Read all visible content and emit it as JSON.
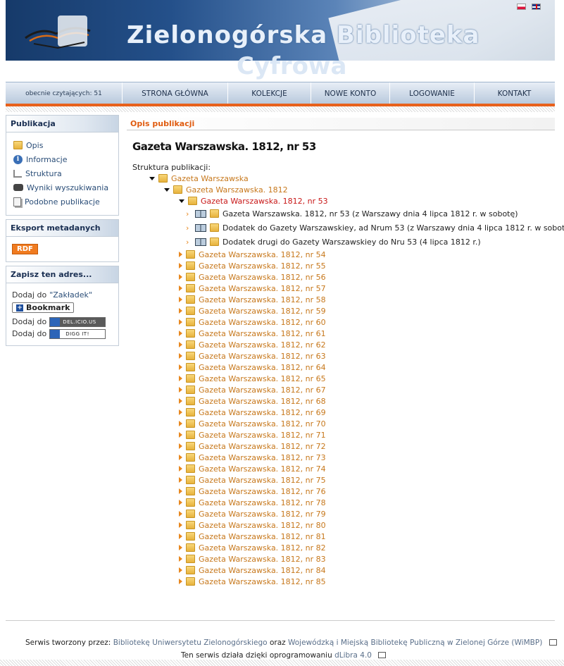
{
  "header": {
    "title_line1": "Zielonogórska Biblioteka",
    "title_line2": "Cyfrowa"
  },
  "nav": {
    "readers": "obecnie czytających: 51",
    "items": [
      "STRONA GŁÓWNA",
      "KOLEKCJE",
      "NOWE KONTO",
      "LOGOWANIE",
      "KONTAKT"
    ]
  },
  "sidebar": {
    "publication": {
      "title": "Publikacja",
      "items": [
        {
          "label": "Opis",
          "icon": "folder-icon"
        },
        {
          "label": "Informacje",
          "icon": "info-icon"
        },
        {
          "label": "Struktura",
          "icon": "tree-icon"
        },
        {
          "label": "Wyniki wyszukiwania",
          "icon": "binoculars-icon"
        },
        {
          "label": "Podobne publikacje",
          "icon": "documents-icon"
        }
      ]
    },
    "export": {
      "title": "Eksport metadanych",
      "rdf": "RDF"
    },
    "save": {
      "title": "Zapisz ten adres...",
      "add_to": "Dodaj do",
      "bookmarks_link": "\"Zakładek\"",
      "bookmark_button": "Bookmark",
      "delicious": "DEL.ICIO.US",
      "digg": "DIGG IT!"
    }
  },
  "main": {
    "section_title": "Opis publikacji",
    "pub_title": "Gazeta Warszawska. 1812, nr 53",
    "structure_label": "Struktura publikacji:",
    "tree": {
      "root": "Gazeta Warszawska",
      "year": "Gazeta Warszawska. 1812",
      "current": "Gazeta Warszawska. 1812, nr 53",
      "docs": [
        "Gazeta Warszawska. 1812, nr 53 (z Warszawy dnia 4 lipca 1812 r. w sobotę)",
        "Dodatek do Gazety Warszawskiey, ad Nrum 53 (z Warszawy dnia 4 lipca 1812 r. w sobotę)",
        "Dodatek drugi do Gazety Warszawskiey do Nru 53 (4 lipca 1812 r.)"
      ],
      "issues": [
        "Gazeta Warszawska. 1812, nr 54",
        "Gazeta Warszawska. 1812, nr 55",
        "Gazeta Warszawska. 1812, nr 56",
        "Gazeta Warszawska. 1812, nr 57",
        "Gazeta Warszawska. 1812, nr 58",
        "Gazeta Warszawska. 1812, nr 59",
        "Gazeta Warszawska. 1812, nr 60",
        "Gazeta Warszawska. 1812, nr 61",
        "Gazeta Warszawska. 1812, nr 62",
        "Gazeta Warszawska. 1812, nr 63",
        "Gazeta Warszawska. 1812, nr 64",
        "Gazeta Warszawska. 1812, nr 65",
        "Gazeta Warszawska. 1812, nr 67",
        "Gazeta Warszawska. 1812, nr 68",
        "Gazeta Warszawska. 1812, nr 69",
        "Gazeta Warszawska. 1812, nr 70",
        "Gazeta Warszawska. 1812, nr 71",
        "Gazeta Warszawska. 1812, nr 72",
        "Gazeta Warszawska. 1812, nr 73",
        "Gazeta Warszawska. 1812, nr 74",
        "Gazeta Warszawska. 1812, nr 75",
        "Gazeta Warszawska. 1812, nr 76",
        "Gazeta Warszawska. 1812, nr 78",
        "Gazeta Warszawska. 1812, nr 79",
        "Gazeta Warszawska. 1812, nr 80",
        "Gazeta Warszawska. 1812, nr 81",
        "Gazeta Warszawska. 1812, nr 82",
        "Gazeta Warszawska. 1812, nr 83",
        "Gazeta Warszawska. 1812, nr 84",
        "Gazeta Warszawska. 1812, nr 85"
      ]
    }
  },
  "footer": {
    "line1_prefix": "Serwis tworzony przez:",
    "link1": "Bibliotekę Uniwersytetu Zielonogórskiego",
    "conj": "oraz",
    "link2": "Wojewódzką i Miejską Bibliotekę Publiczną w Zielonej Górze (WiMBP)",
    "line2_prefix": "Ten serwis działa dzięki oprogramowaniu",
    "link3": "dLibra 4.0"
  },
  "colors": {
    "accent": "#e8611c",
    "link": "#c7781c",
    "current": "#c81818",
    "nav_text": "#1d2f4a"
  }
}
